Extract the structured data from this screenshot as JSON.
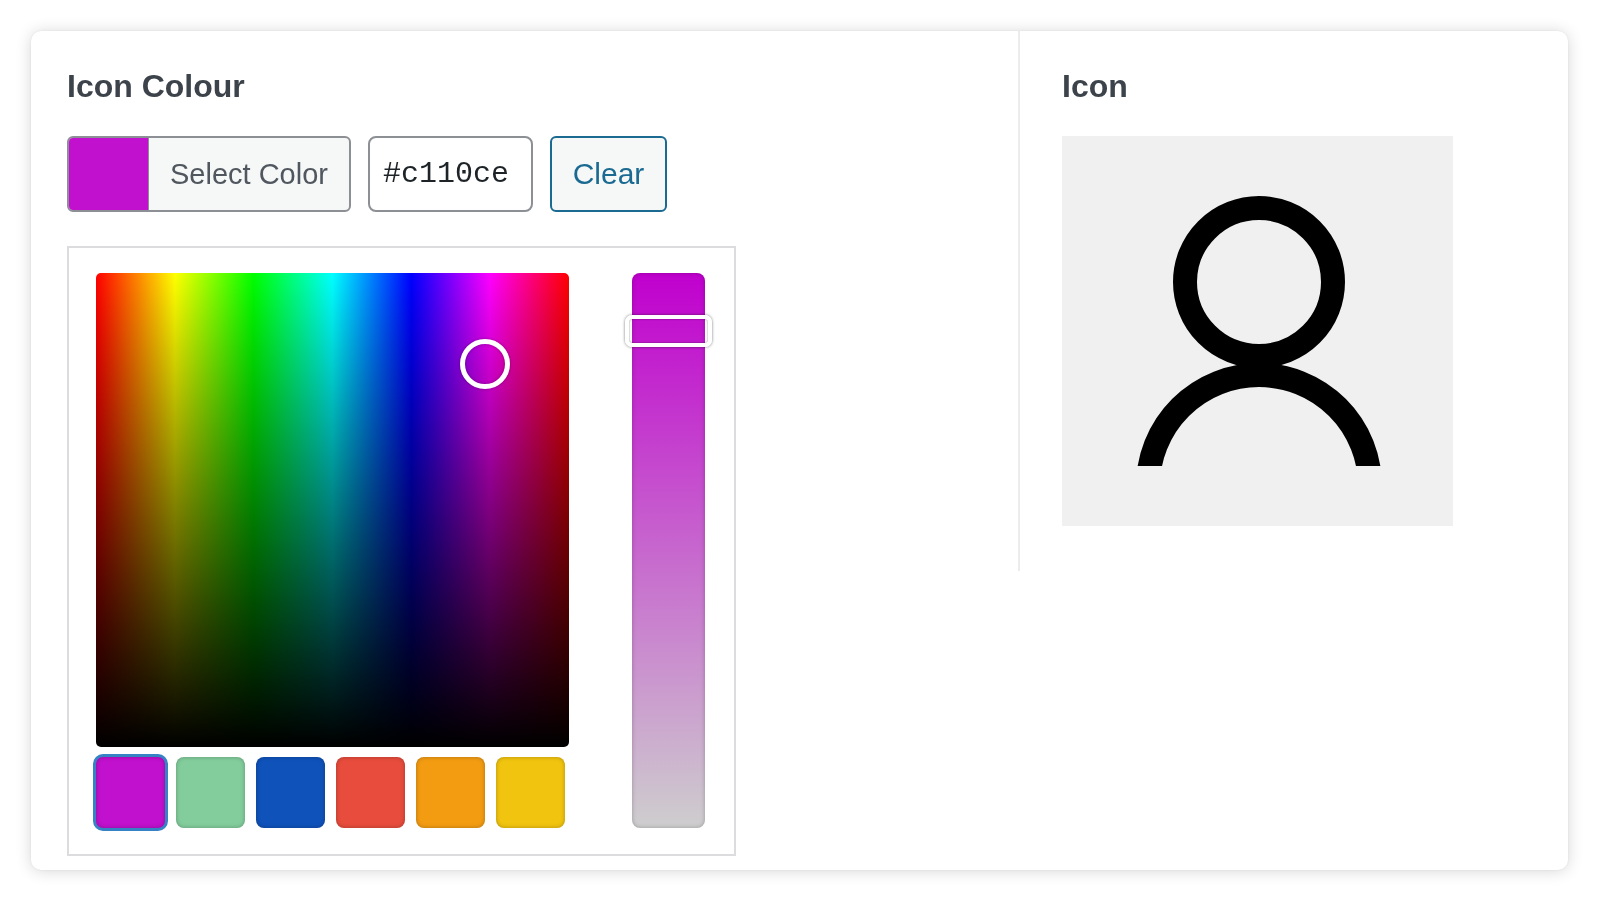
{
  "color_setting": {
    "heading": "Icon Colour",
    "select_button": {
      "label": "Select Color"
    },
    "hex_input": {
      "value": "#c110ce"
    },
    "clear_button": {
      "label": "Clear"
    },
    "picker": {
      "slider": {
        "level": 0.92
      },
      "swatches": [
        {
          "color": "#c110ce",
          "selected": true
        },
        {
          "color": "#83cd9c",
          "selected": false
        },
        {
          "color": "#0f52ba",
          "selected": false
        },
        {
          "color": "#e74c3c",
          "selected": false
        },
        {
          "color": "#f39c12",
          "selected": false
        },
        {
          "color": "#f1c40f",
          "selected": false
        }
      ]
    }
  },
  "icon_setting": {
    "heading": "Icon"
  }
}
